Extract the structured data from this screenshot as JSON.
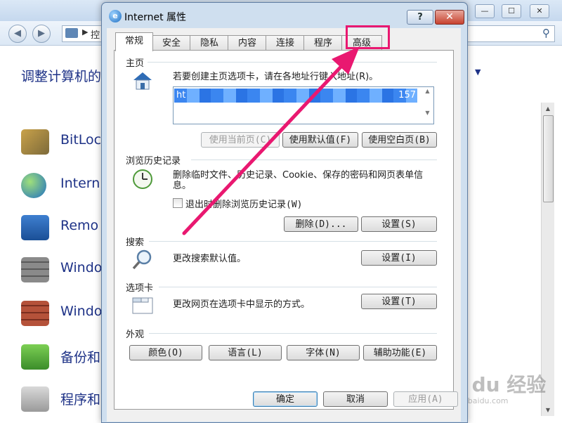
{
  "background_window": {
    "address_crumb": "控",
    "heading": "调整计算机的",
    "items": [
      {
        "label": "BitLoc",
        "icon": "bitlocker-keys-icon"
      },
      {
        "label": "Intern",
        "icon": "internet-options-globe-icon"
      },
      {
        "label": "Remo",
        "icon": "remote-app-icon"
      },
      {
        "label": "Windo",
        "icon": "firewall-wall-icon"
      },
      {
        "label": "Windo",
        "icon": "firewall-globe-icon"
      },
      {
        "label": "备份和",
        "icon": "backup-restore-icon"
      },
      {
        "label": "程序和",
        "icon": "programs-features-icon"
      }
    ],
    "window_controls": {
      "minimize": "—",
      "maximize": "☐",
      "close": "✕"
    }
  },
  "dialog": {
    "title": "Internet 属性",
    "help": "?",
    "close": "✕",
    "tabs": [
      "常规",
      "安全",
      "隐私",
      "内容",
      "连接",
      "程序",
      "高级"
    ],
    "active_tab": "常规",
    "homepage": {
      "title": "主页",
      "description": "若要创建主页选项卡，请在各地址行键入地址(R)。",
      "url_start": "ht",
      "url_end": "157",
      "btn_current": "使用当前页(C)",
      "btn_default": "使用默认值(F)",
      "btn_blank": "使用空白页(B)"
    },
    "history": {
      "title": "浏览历史记录",
      "description": "删除临时文件、历史记录、Cookie、保存的密码和网页表单信息。",
      "checkbox_label": "退出时删除浏览历史记录(W)",
      "checkbox_checked": false,
      "btn_delete": "删除(D)...",
      "btn_settings": "设置(S)"
    },
    "search": {
      "title": "搜索",
      "description": "更改搜索默认值。",
      "btn_settings": "设置(I)"
    },
    "tabs_section": {
      "title": "选项卡",
      "description": "更改网页在选项卡中显示的方式。",
      "btn_settings": "设置(T)"
    },
    "appearance": {
      "title": "外观",
      "btn_colors": "颜色(O)",
      "btn_languages": "语言(L)",
      "btn_fonts": "字体(N)",
      "btn_accessibility": "辅助功能(E)"
    },
    "footer": {
      "ok": "确定",
      "cancel": "取消",
      "apply": "应用(A)"
    }
  },
  "annotation": {
    "color": "#e91870",
    "highlight_target": "高级"
  },
  "watermark": {
    "main": "Bai du 经验",
    "sub": "jingyan.baidu.com"
  }
}
